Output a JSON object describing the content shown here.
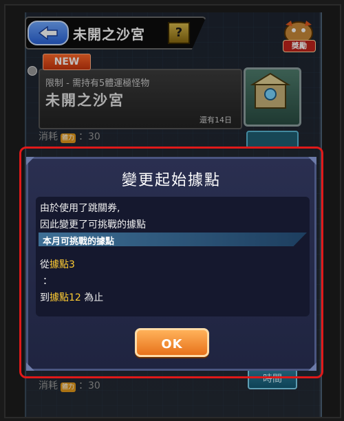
{
  "header": {
    "title": "未開之沙宮",
    "help_label": "?",
    "reward_label": "獎勵"
  },
  "quest": {
    "new_label": "NEW",
    "subtitle": "限制 - 需持有5體運極怪物",
    "name": "未開之沙宮",
    "remaining": "還有14日",
    "stamina_label": "消耗",
    "stamina_icon_label": "體力",
    "stamina_value": "：30",
    "time_label": "時間"
  },
  "dialog": {
    "title": "變更起始據點",
    "message_line1": "由於使用了跳關券,",
    "message_line2": "因此變更了可挑戰的據點",
    "bar_label": "本月可挑戰的據點",
    "from_prefix": "從",
    "from_point": "據點3",
    "colon": "：",
    "to_prefix": "到",
    "to_point": "據點12",
    "to_suffix": " 為止",
    "ok_label": "OK"
  },
  "colors": {
    "highlight": "#e01919",
    "accent_gold": "#ffcc33",
    "ok_button": "#e7721b"
  }
}
